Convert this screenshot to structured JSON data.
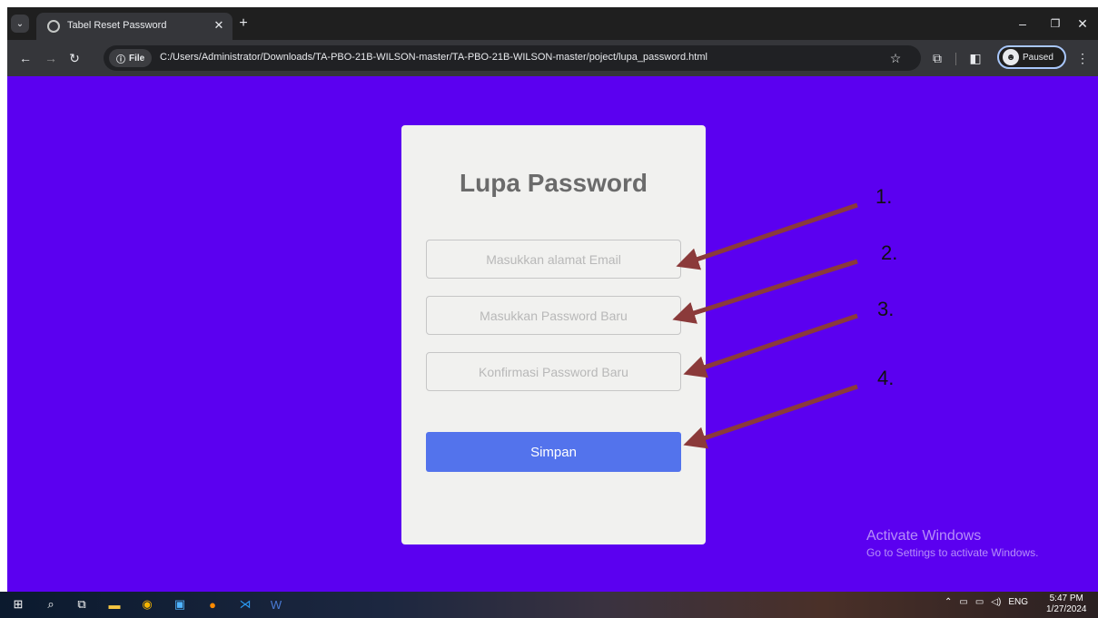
{
  "browser": {
    "tab_title": "Tabel Reset Password",
    "file_chip_label": "File",
    "url": "C:/Users/Administrator/Downloads/TA-PBO-21B-WILSON-master/TA-PBO-21B-WILSON-master/poject/lupa_password.html",
    "profile_label": "Paused"
  },
  "page": {
    "title": "Lupa Password",
    "email_placeholder": "Masukkan alamat Email",
    "new_password_placeholder": "Masukkan Password Baru",
    "confirm_password_placeholder": "Konfirmasi Password Baru",
    "save_label": "Simpan"
  },
  "annotations": {
    "color": "#8b3a3a",
    "labels": [
      "1.",
      "2.",
      "3.",
      "4."
    ]
  },
  "watermark": {
    "title": "Activate Windows",
    "subtitle": "Go to Settings to activate Windows."
  },
  "taskbar": {
    "language": "ENG",
    "time": "5:47 PM",
    "date": "1/27/2024"
  }
}
